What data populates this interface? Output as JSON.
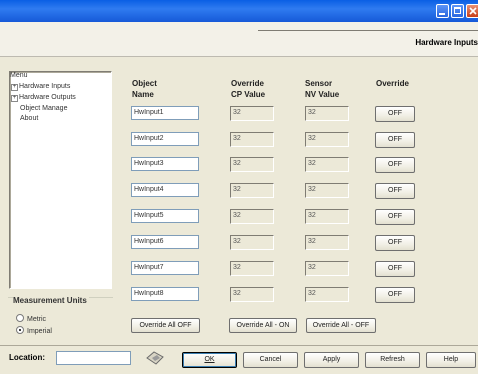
{
  "window": {
    "controls": [
      "minimize-icon",
      "maximize-icon",
      "close-icon"
    ],
    "accent_color": "#0a5fe4"
  },
  "header": {
    "section_title": "Hardware Inputs"
  },
  "menu": {
    "heading": "Menu",
    "items": [
      {
        "label": "Hardware Inputs",
        "expander": "+"
      },
      {
        "label": "Hardware Outputs",
        "expander": "+"
      },
      {
        "label": "Object Manage",
        "expander": ""
      },
      {
        "label": "About",
        "expander": ""
      }
    ]
  },
  "units": {
    "title": "Measurement Units",
    "options": [
      {
        "label": "Metric",
        "selected": false
      },
      {
        "label": "Imperial",
        "selected": true
      }
    ]
  },
  "table": {
    "headers": {
      "object_line1": "Object",
      "object_line2": "Name",
      "cp_line1": "Override",
      "cp_line2": "CP Value",
      "nv_line1": "Sensor",
      "nv_line2": "NV Value",
      "override": "Override"
    },
    "rows": [
      {
        "name": "HwInput1",
        "cp": "32",
        "nv": "32",
        "override": "OFF"
      },
      {
        "name": "HwInput2",
        "cp": "32",
        "nv": "32",
        "override": "OFF"
      },
      {
        "name": "HwInput3",
        "cp": "32",
        "nv": "32",
        "override": "OFF"
      },
      {
        "name": "HwInput4",
        "cp": "32",
        "nv": "32",
        "override": "OFF"
      },
      {
        "name": "HwInput5",
        "cp": "32",
        "nv": "32",
        "override": "OFF"
      },
      {
        "name": "HwInput6",
        "cp": "32",
        "nv": "32",
        "override": "OFF"
      },
      {
        "name": "HwInput7",
        "cp": "32",
        "nv": "32",
        "override": "OFF"
      },
      {
        "name": "HwInput8",
        "cp": "32",
        "nv": "32",
        "override": "OFF"
      }
    ]
  },
  "bulk": {
    "override_all_off": "Override All OFF",
    "override_all_on": "Override All - ON",
    "override_all_off2": "Override All - OFF"
  },
  "footer": {
    "location_label": "Location:",
    "location_value": "",
    "ok": "OK",
    "cancel": "Cancel",
    "apply": "Apply",
    "refresh": "Refresh",
    "help": "Help"
  }
}
